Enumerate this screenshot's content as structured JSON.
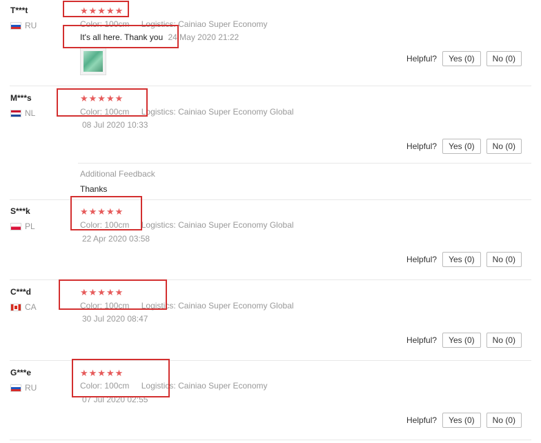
{
  "labels": {
    "color_key": "Color:",
    "logistics_key": "Logistics:",
    "helpful": "Helpful?",
    "additional_feedback": "Additional Feedback"
  },
  "stars": "★★★★★",
  "reviews": [
    {
      "user": "T***t",
      "country": "RU",
      "rating": 5,
      "color": "100cm",
      "logistics": "Cainiao Super Economy",
      "text": "It's all here. Thank you",
      "date": "24 May 2020 21:22",
      "yes": "Yes (0)",
      "no": "No (0)"
    },
    {
      "user": "M***s",
      "country": "NL",
      "rating": 5,
      "color": "100cm",
      "logistics": "Cainiao Super Economy Global",
      "date": "08 Jul 2020 10:33",
      "yes": "Yes (0)",
      "no": "No (0)",
      "additional_feedback": "Thanks"
    },
    {
      "user": "S***k",
      "country": "PL",
      "rating": 5,
      "color": "100cm",
      "logistics": "Cainiao Super Economy Global",
      "date": "22 Apr 2020 03:58",
      "yes": "Yes (0)",
      "no": "No (0)"
    },
    {
      "user": "C***d",
      "country": "CA",
      "rating": 5,
      "color": "100cm",
      "logistics": "Cainiao Super Economy Global",
      "date": "30 Jul 2020 08:47",
      "yes": "Yes (0)",
      "no": "No (0)"
    },
    {
      "user": "G***e",
      "country": "RU",
      "rating": 5,
      "color": "100cm",
      "logistics": "Cainiao Super Economy",
      "date": "07 Jul 2020 02:55",
      "yes": "Yes (0)",
      "no": "No (0)"
    }
  ]
}
